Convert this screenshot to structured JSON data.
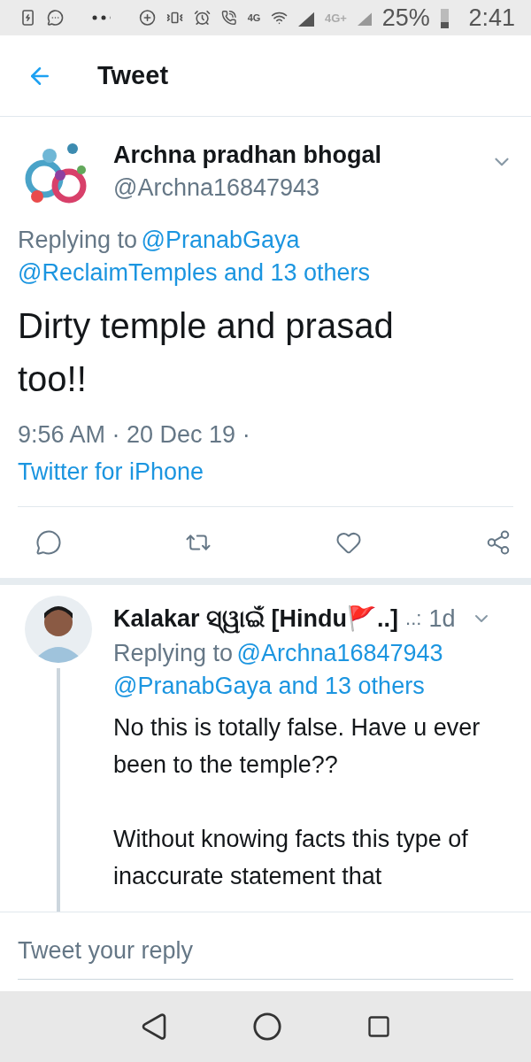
{
  "status_bar": {
    "network_4g": "4G",
    "network_4g_plus": "4G+",
    "battery": "25%",
    "time": "2:41"
  },
  "header": {
    "title": "Tweet"
  },
  "tweet": {
    "name": "Archna pradhan bhogal",
    "handle": "@Archna16847943",
    "replying_prefix": "Replying to",
    "replying_to": [
      "@PranabGaya",
      "@ReclaimTemples and 13 others"
    ],
    "text": "Dirty temple and prasad too!!",
    "time": "9:56 AM · 20 Dec 19 · ",
    "source": "Twitter for iPhone"
  },
  "reply": {
    "name": "Kalakar ସ୍ୱାଇଁ [Hindu🚩..]",
    "more": "..:",
    "age": "1d",
    "replying_prefix": "Replying to",
    "replying_to": [
      "@Archna16847943",
      "@PranabGaya and 13 others"
    ],
    "paragraphs": [
      "No this is totally false.  Have u ever been to the temple??",
      "Without knowing facts this type of inaccurate statement that"
    ]
  },
  "composer": {
    "placeholder": "Tweet your reply"
  }
}
